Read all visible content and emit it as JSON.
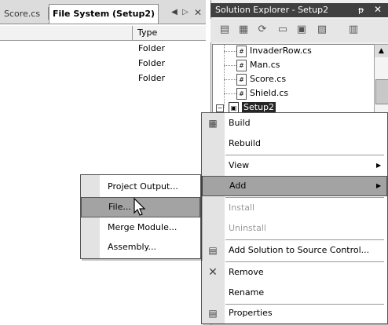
{
  "tabs": [
    {
      "label": "Score.cs",
      "active": false
    },
    {
      "label": "File System (Setup2)",
      "active": true
    }
  ],
  "tab_nav": {
    "prev": "◀",
    "next": "▷",
    "close": "✕"
  },
  "filelist": {
    "type_header": "Type",
    "rows": [
      {
        "type": "Folder"
      },
      {
        "type": "Folder"
      },
      {
        "type": "Folder"
      }
    ]
  },
  "solution_explorer": {
    "title": "Solution Explorer - Setup2",
    "pin": "ᵽ",
    "close": "✕",
    "toolbar_icons": [
      "properties-icon",
      "show-all-icon",
      "refresh-icon",
      "view-code-icon",
      "view-designer-icon",
      "file-editor-icon",
      "class-view-icon"
    ],
    "tree": [
      {
        "label": "InvaderRow.cs",
        "icon": "cs-file-icon"
      },
      {
        "label": "Man.cs",
        "icon": "cs-file-icon"
      },
      {
        "label": "Score.cs",
        "icon": "cs-file-icon"
      },
      {
        "label": "Shield.cs",
        "icon": "cs-file-icon"
      }
    ],
    "setup_node": {
      "label": "Setup2",
      "expander": "−"
    }
  },
  "context_menu": {
    "items": [
      {
        "label": "Build",
        "icon": "build-icon"
      },
      {
        "label": "Rebuild"
      },
      {
        "label": "View",
        "submenu": true
      },
      {
        "label": "Add",
        "submenu": true,
        "highlighted": true
      },
      {
        "label": "Install",
        "disabled": true
      },
      {
        "label": "Uninstall",
        "disabled": true
      },
      {
        "label": "Add Solution to Source Control...",
        "icon": "source-control-icon"
      },
      {
        "label": "Remove",
        "icon": "remove-icon"
      },
      {
        "label": "Rename"
      },
      {
        "label": "Properties",
        "icon": "properties-icon"
      }
    ]
  },
  "add_submenu": {
    "items": [
      {
        "label": "Project Output..."
      },
      {
        "label": "File...",
        "highlighted": true
      },
      {
        "label": "Merge Module..."
      },
      {
        "label": "Assembly..."
      }
    ]
  }
}
